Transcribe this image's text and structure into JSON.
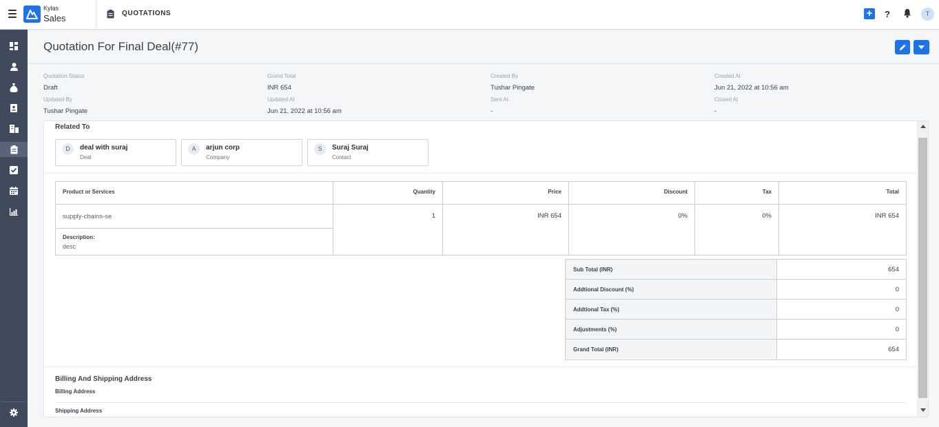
{
  "app": {
    "brand_small": "Kylas",
    "brand_large": "Sales",
    "module_title": "QUOTATIONS",
    "help_label": "?",
    "avatar_initial": "T",
    "add_label": "+"
  },
  "colors": {
    "primary": "#1e73e8",
    "sidebar": "#414a5c",
    "sidebar_active": "#59637a"
  },
  "sidebar": {
    "items": [
      {
        "icon": "dashboard-icon"
      },
      {
        "icon": "user-icon"
      },
      {
        "icon": "money-bag-icon"
      },
      {
        "icon": "contact-card-icon"
      },
      {
        "icon": "buildings-icon"
      },
      {
        "icon": "quotation-icon",
        "active": true
      },
      {
        "icon": "checkbox-icon"
      },
      {
        "icon": "calendar-icon"
      },
      {
        "icon": "reports-icon"
      }
    ],
    "settings_icon": "gear-icon"
  },
  "page": {
    "title": "Quotation For Final Deal(#77)"
  },
  "meta": {
    "quotation_status": {
      "label": "Quotation Status",
      "value": "Draft"
    },
    "grand_total": {
      "label": "Grand Total",
      "value": "INR 654"
    },
    "created_by": {
      "label": "Created By",
      "value": "Tushar Pingate"
    },
    "created_at": {
      "label": "Created At",
      "value": "Jun 21, 2022 at 10:56 am"
    },
    "updated_by": {
      "label": "Updated By",
      "value": "Tushar Pingate"
    },
    "updated_at": {
      "label": "Updated At",
      "value": "Jun 21, 2022 at 10:56 am"
    },
    "sent_at": {
      "label": "Sent At",
      "value": "-"
    },
    "closed_at": {
      "label": "Closed At",
      "value": "-"
    }
  },
  "related": {
    "title": "Related To",
    "items": [
      {
        "initial": "D",
        "name": "deal with suraj",
        "type": "Deal"
      },
      {
        "initial": "A",
        "name": "arjun corp",
        "type": "Company"
      },
      {
        "initial": "S",
        "name": "Suraj Suraj",
        "type": "Contact"
      }
    ]
  },
  "products": {
    "headers": {
      "product": "Product or Services",
      "quantity": "Quantity",
      "price": "Price",
      "discount": "Discount",
      "tax": "Tax",
      "total": "Total"
    },
    "rows": [
      {
        "product": "supply-chains-se",
        "quantity": "1",
        "price": "INR 654",
        "discount": "0%",
        "tax": "0%",
        "total": "INR 654",
        "description_label": "Description:",
        "description": "desc"
      }
    ]
  },
  "totals": [
    {
      "label": "Sub Total (INR)",
      "value": "654"
    },
    {
      "label": "Addtional Discount (%)",
      "value": "0"
    },
    {
      "label": "Addtional Tax (%)",
      "value": "0"
    },
    {
      "label": "Adjustments (%)",
      "value": "0"
    },
    {
      "label": "Grand Total (INR)",
      "value": "654"
    }
  ],
  "address": {
    "title": "Billing And Shipping Address",
    "billing_label": "Billing Address",
    "shipping_label": "Shipping Address"
  }
}
